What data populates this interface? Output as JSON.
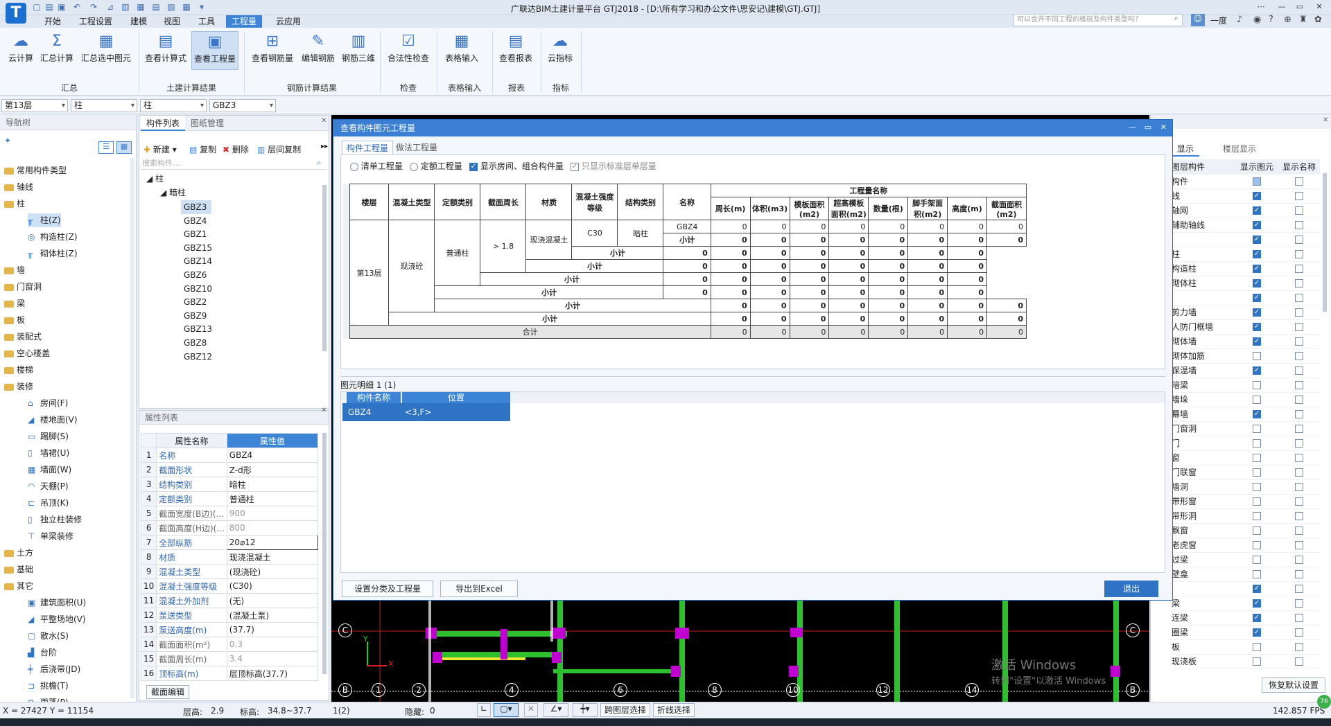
{
  "app": {
    "title": "广联达BIM土建计量平台 GTJ2018 - [D:\\所有学习和办公文件\\思安记\\建模\\GTJ.GTJ]",
    "logo": "T",
    "search_placeholder": "可以会开不同工程的楼层及构件类型吗？",
    "user": "一度",
    "window_controls": [
      "⋯",
      "—",
      "▭",
      "✕"
    ]
  },
  "menu": [
    "开始",
    "工程设置",
    "建模",
    "视图",
    "工具",
    "工程量",
    "云应用"
  ],
  "menu_active": "工程量",
  "ribbon": {
    "buttons": [
      {
        "label": "云计算",
        "icon": "☁"
      },
      {
        "label": "汇总计算",
        "icon": "Σ"
      },
      {
        "label": "汇总选中图元",
        "icon": "▦"
      },
      {
        "label": "查看计算式",
        "icon": "▤"
      },
      {
        "label": "查看工程量",
        "icon": "▣",
        "active": true
      },
      {
        "label": "查看钢筋量",
        "icon": "⊞"
      },
      {
        "label": "编辑钢筋",
        "icon": "✎"
      },
      {
        "label": "钢筋三维",
        "icon": "▥"
      },
      {
        "label": "合法性检查",
        "icon": "☑"
      },
      {
        "label": "表格输入",
        "icon": "▦"
      },
      {
        "label": "查看报表",
        "icon": "▤"
      },
      {
        "label": "云指标",
        "icon": "☁"
      }
    ],
    "groups": [
      "汇总",
      "土建计算结果",
      "钢筋计算结果",
      "检查",
      "表格输入",
      "报表",
      "指标"
    ]
  },
  "combos": [
    "第13层",
    "柱",
    "柱",
    "GBZ3"
  ],
  "nav": {
    "title": "导航树",
    "categories": [
      {
        "label": "常用构件类型"
      },
      {
        "label": "轴线"
      },
      {
        "label": "柱",
        "children": [
          {
            "label": "柱(Z)",
            "icon": "╥",
            "selected": true
          },
          {
            "label": "构造柱(Z)",
            "icon": "◎"
          },
          {
            "label": "砌体柱(Z)",
            "icon": "╥"
          }
        ]
      },
      {
        "label": "墙"
      },
      {
        "label": "门窗洞"
      },
      {
        "label": "梁"
      },
      {
        "label": "板"
      },
      {
        "label": "装配式"
      },
      {
        "label": "空心楼盖"
      },
      {
        "label": "楼梯"
      },
      {
        "label": "装修",
        "children": [
          {
            "label": "房间(F)",
            "icon": "⌂"
          },
          {
            "label": "楼地面(V)",
            "icon": "◢"
          },
          {
            "label": "踢脚(S)",
            "icon": "▭"
          },
          {
            "label": "墙裙(U)",
            "icon": "▯"
          },
          {
            "label": "墙面(W)",
            "icon": "▦"
          },
          {
            "label": "天棚(P)",
            "icon": "◠"
          },
          {
            "label": "吊顶(K)",
            "icon": "⊏"
          },
          {
            "label": "独立柱装修",
            "icon": "▯"
          },
          {
            "label": "单梁装修",
            "icon": "⊤"
          }
        ]
      },
      {
        "label": "土方"
      },
      {
        "label": "基础"
      },
      {
        "label": "其它",
        "children": [
          {
            "label": "建筑面积(U)",
            "icon": "▣"
          },
          {
            "label": "平整场地(V)",
            "icon": "◢"
          },
          {
            "label": "散水(S)",
            "icon": "▢"
          },
          {
            "label": "台阶",
            "icon": "▟"
          },
          {
            "label": "后浇带(JD)",
            "icon": "╪"
          },
          {
            "label": "挑檐(T)",
            "icon": "⊐"
          },
          {
            "label": "雨蓬(P)",
            "icon": "⊓"
          }
        ]
      }
    ]
  },
  "component_panel": {
    "tabs": [
      "构件列表",
      "图纸管理"
    ],
    "toolbar": [
      "新建",
      "复制",
      "删除",
      "层间复制"
    ],
    "search_placeholder": "搜索构件...",
    "tree_root": "柱",
    "tree_child": "暗柱",
    "items": [
      "GBZ3",
      "GBZ4",
      "GBZ1",
      "GBZ15",
      "GBZ14",
      "GBZ6",
      "GBZ10",
      "GBZ2",
      "GBZ9",
      "GBZ13",
      "GBZ8",
      "GBZ12"
    ],
    "selected": "GBZ3"
  },
  "properties": {
    "title": "属性列表",
    "col_name": "属性名称",
    "col_value": "属性值",
    "edit_button": "截面编辑",
    "rows": [
      [
        "1",
        "名称",
        "GBZ4"
      ],
      [
        "2",
        "截面形状",
        "Z-d形"
      ],
      [
        "3",
        "结构类别",
        "暗柱"
      ],
      [
        "4",
        "定额类别",
        "普通柱"
      ],
      [
        "5",
        "截面宽度(B边)(...",
        "900"
      ],
      [
        "6",
        "截面高度(H边)(...",
        "800"
      ],
      [
        "7",
        "全部纵筋",
        "20⌀12"
      ],
      [
        "8",
        "材质",
        "现浇混凝土"
      ],
      [
        "9",
        "混凝土类型",
        "(现浇砼)"
      ],
      [
        "10",
        "混凝土强度等级",
        "(C30)"
      ],
      [
        "11",
        "混凝土外加剂",
        "(无)"
      ],
      [
        "12",
        "泵送类型",
        "(混凝土泵)"
      ],
      [
        "13",
        "泵送高度(m)",
        "(37.7)"
      ],
      [
        "14",
        "截面面积(m²)",
        "0.3"
      ],
      [
        "15",
        "截面周长(m)",
        "3.4"
      ],
      [
        "16",
        "顶标高(m)",
        "层顶标高(37.7)"
      ]
    ]
  },
  "dialog": {
    "title": "查看构件图元工程量",
    "tabs": [
      "构件工程量",
      "做法工程量"
    ],
    "options": [
      {
        "label": "清单工程量",
        "checked": false
      },
      {
        "label": "定额工程量",
        "checked": false
      },
      {
        "label": "显示房间、组合构件量",
        "checked": true
      },
      {
        "label": "只显示标准层单层量",
        "checked": true
      }
    ],
    "table": {
      "headers": [
        "楼层",
        "混凝土类型",
        "定额类别",
        "截面周长",
        "材质",
        "混凝土强度等级",
        "结构类别",
        "名称"
      ],
      "group_header": "工程量名称",
      "qty_headers": [
        "周长(m)",
        "体积(m3)",
        "模板面积(m2)",
        "超高模板面积(m2)",
        "数量(根)",
        "脚手架面积(m2)",
        "高度(m)",
        "截面面积(m2)"
      ],
      "floor": "第13层",
      "concrete": "现浇砼",
      "quota": "普通柱",
      "perimeter": "> 1.8",
      "material": "现浇混凝土",
      "grade": "C30",
      "struct": "暗柱",
      "name": "GBZ4",
      "subtotal": "小计",
      "total": "合计",
      "zero": "0"
    },
    "detail": {
      "title": "图元明细",
      "count": "1 (1)",
      "headers": [
        "构件名称",
        "位置"
      ],
      "rows": [
        [
          "GBZ4",
          "<3,F>"
        ]
      ]
    },
    "buttons": [
      "设置分类及工程量",
      "导出到Excel",
      "退出"
    ]
  },
  "right_panel": {
    "tabs": [
      "显示",
      "楼层显示"
    ],
    "headers": [
      "图层构件",
      "显示图元",
      "显示名称"
    ],
    "reset_button": "恢复默认设置",
    "rows": [
      [
        "构件",
        "blue",
        false
      ],
      [
        "线",
        true,
        false
      ],
      [
        "轴网",
        true,
        false
      ],
      [
        "辅助轴线",
        true,
        false
      ],
      [
        "",
        true,
        false
      ],
      [
        "柱",
        true,
        false
      ],
      [
        "构造柱",
        true,
        false
      ],
      [
        "砌体柱",
        true,
        false
      ],
      [
        "",
        true,
        false
      ],
      [
        "剪力墙",
        true,
        false
      ],
      [
        "人防门框墙",
        true,
        false
      ],
      [
        "砌体墙",
        true,
        false
      ],
      [
        "砌体加筋",
        false,
        false
      ],
      [
        "保温墙",
        true,
        false
      ],
      [
        "暗梁",
        false,
        false
      ],
      [
        "墙垛",
        false,
        false
      ],
      [
        "幕墙",
        true,
        false
      ],
      [
        "门窗洞",
        false,
        false
      ],
      [
        "门",
        false,
        false
      ],
      [
        "窗",
        false,
        false
      ],
      [
        "门联窗",
        false,
        false
      ],
      [
        "墙洞",
        false,
        false
      ],
      [
        "带形窗",
        false,
        false
      ],
      [
        "带形洞",
        false,
        false
      ],
      [
        "飘窗",
        false,
        false
      ],
      [
        "老虎窗",
        false,
        false
      ],
      [
        "过梁",
        false,
        false
      ],
      [
        "壁龛",
        false,
        false
      ],
      [
        "",
        true,
        false
      ],
      [
        "梁",
        true,
        false
      ],
      [
        "连梁",
        true,
        false
      ],
      [
        "圈梁",
        true,
        false
      ],
      [
        "板",
        false,
        false
      ],
      [
        "现浇板",
        false,
        false
      ]
    ]
  },
  "cad": {
    "axis_top": [
      "C"
    ],
    "axis_bottom": [
      "B",
      "1",
      "2",
      "4",
      "6",
      "8",
      "10",
      "12",
      "14",
      "B"
    ],
    "watermark1": "激活 Windows",
    "watermark2": "转到\"设置\"以激活 Windows",
    "x": "X",
    "y": "Y"
  },
  "status": {
    "coords": "X = 27427 Y = 11154",
    "floor_height_label": "层高:",
    "floor_height": "2.9",
    "elev_label": "标高:",
    "elev": "34.8~37.7",
    "sel": "1(2)",
    "hidden_label": "隐藏:",
    "hidden": "0",
    "btn1": "跨图层选择",
    "btn2": "折线选择",
    "fps": "142.857 FPS",
    "badge": "76"
  },
  "colors": {
    "accent": "#3a7fd3",
    "cad_bg": "#000000",
    "green": "#2dbf2d",
    "magenta": "#c000d0"
  }
}
